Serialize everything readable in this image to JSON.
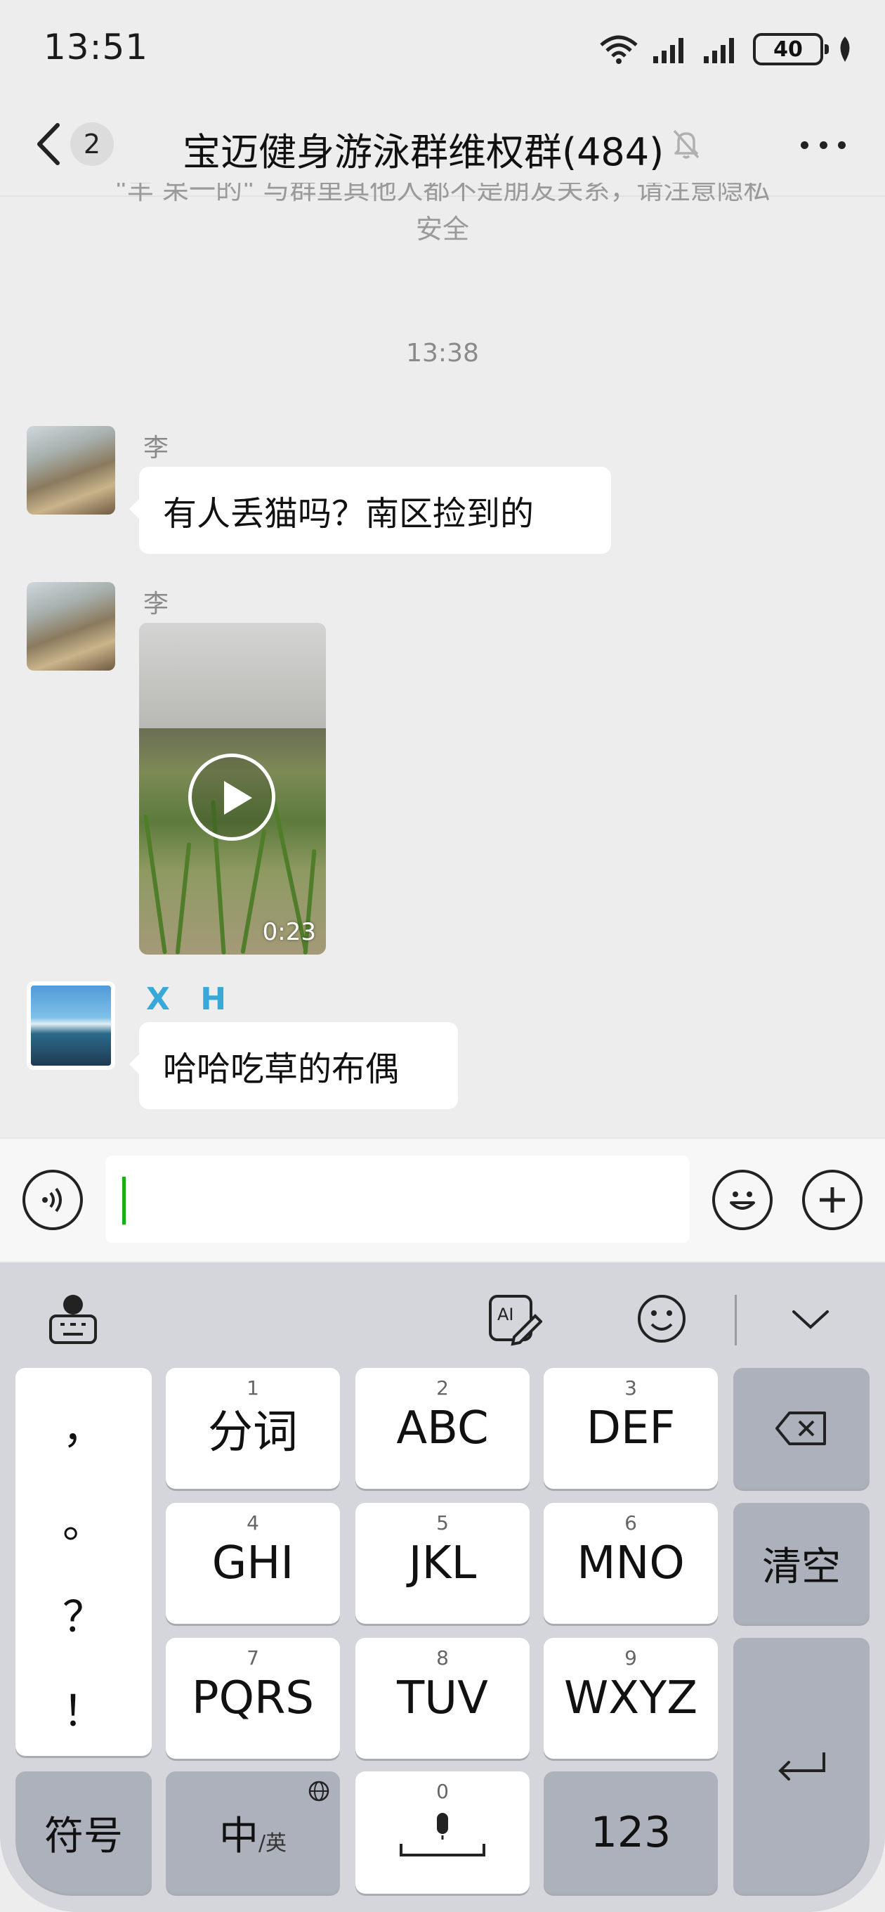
{
  "status_bar": {
    "time": "13:51",
    "battery": "40"
  },
  "header": {
    "unread_count": "2",
    "title": "宝迈健身游泳群维权群(484)"
  },
  "chat": {
    "system_notice_line1": "\"羊 呆一的\" 与群里其他人都不是朋友关系，请注意隐私",
    "system_notice_line2": "安全",
    "time_separator": "13:38",
    "messages": [
      {
        "sender": "李",
        "type": "text",
        "text": "有人丢猫吗？南区捡到的"
      },
      {
        "sender": "李",
        "type": "video",
        "duration": "0:23"
      },
      {
        "sender": "X H",
        "type": "text",
        "text": "哈哈吃草的布偶"
      }
    ]
  },
  "keyboard": {
    "punctuation": [
      "，",
      "。",
      "？",
      "！"
    ],
    "keys": [
      {
        "num": "1",
        "label": "分词"
      },
      {
        "num": "2",
        "label": "ABC"
      },
      {
        "num": "3",
        "label": "DEF"
      },
      {
        "num": "4",
        "label": "GHI"
      },
      {
        "num": "5",
        "label": "JKL"
      },
      {
        "num": "6",
        "label": "MNO"
      },
      {
        "num": "7",
        "label": "PQRS"
      },
      {
        "num": "8",
        "label": "TUV"
      },
      {
        "num": "9",
        "label": "WXYZ"
      }
    ],
    "clear_label": "清空",
    "symbol_label": "符号",
    "lang_label": "中",
    "lang_sub_label": "/英",
    "space_num": "0",
    "numeric_label": "123"
  }
}
